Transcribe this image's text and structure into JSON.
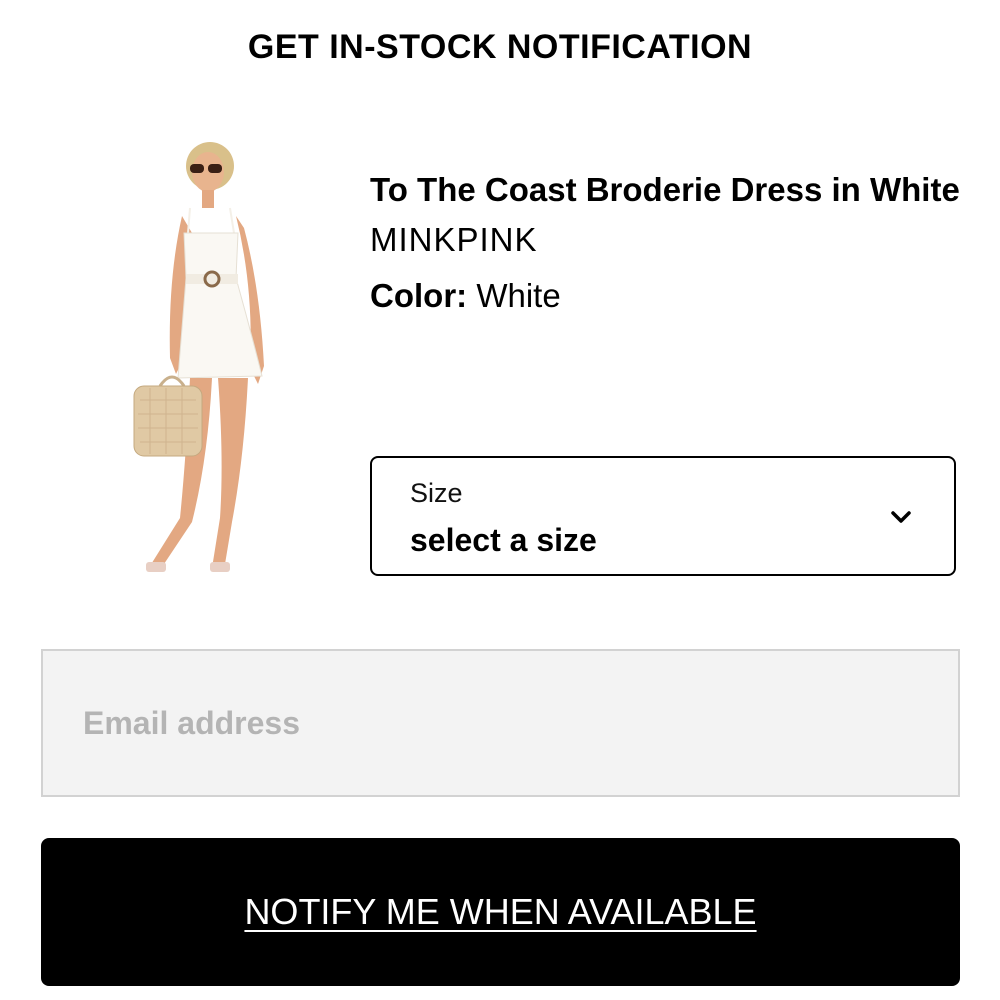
{
  "header": {
    "title": "GET IN-STOCK NOTIFICATION"
  },
  "product": {
    "name": "To The Coast Broderie Dress in White",
    "brand": "MINKPINK",
    "color_label": "Color:",
    "color_value": "White",
    "image_icon": "product-photo-model-white-dress"
  },
  "size_selector": {
    "label": "Size",
    "value": "select a size",
    "icon": "chevron-down-icon"
  },
  "email": {
    "value": "",
    "placeholder": "Email address"
  },
  "notify_button": {
    "label": "NOTIFY ME WHEN AVAILABLE"
  },
  "colors": {
    "button_bg": "#000000",
    "input_bg": "#f3f3f3",
    "input_border": "#d2d2d2",
    "placeholder": "#b4b4b4"
  }
}
